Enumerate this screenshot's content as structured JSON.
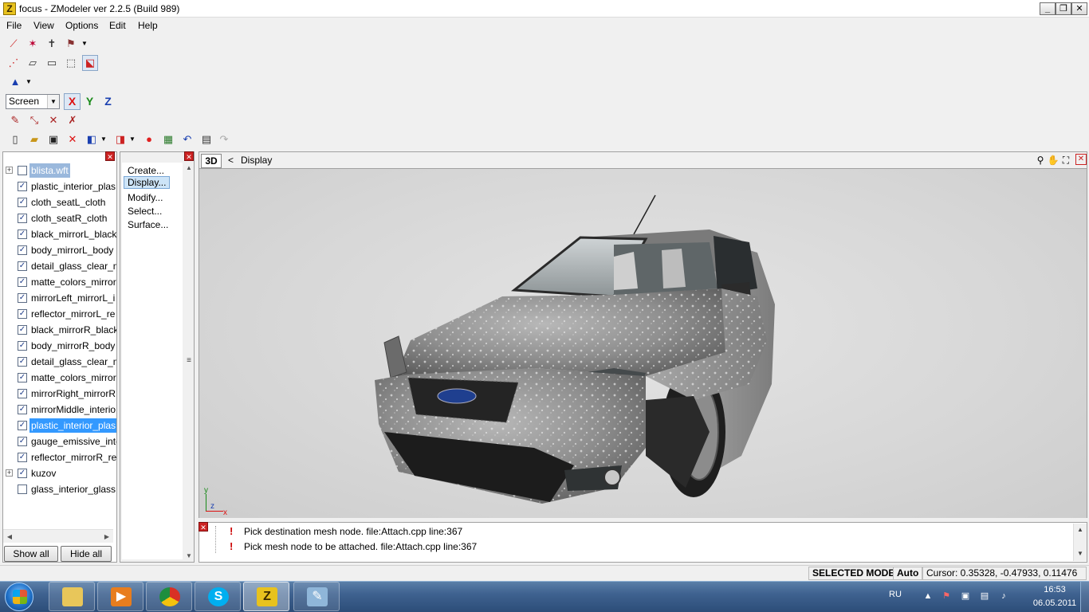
{
  "window": {
    "app_icon_letter": "Z",
    "title": "focus - ZModeler ver 2.2.5 (Build 989)",
    "minimize": "_",
    "maximize": "❐",
    "close": "✕"
  },
  "menu": {
    "items": [
      "File",
      "View",
      "Options",
      "Edit",
      "Help"
    ]
  },
  "toolbar": {
    "space_select": "Screen",
    "axis_x": "X",
    "axis_y": "Y",
    "axis_z": "Z"
  },
  "tree": {
    "close": "✕",
    "items": [
      {
        "label": "blista.wft",
        "checked": false,
        "expander": "+",
        "state": "root-selected"
      },
      {
        "label": "plastic_interior_plas",
        "checked": true
      },
      {
        "label": "cloth_seatL_cloth",
        "checked": true
      },
      {
        "label": "cloth_seatR_cloth",
        "checked": true
      },
      {
        "label": "black_mirrorL_black",
        "checked": true
      },
      {
        "label": "body_mirrorL_body",
        "checked": true
      },
      {
        "label": "detail_glass_clear_m",
        "checked": true
      },
      {
        "label": "matte_colors_mirror",
        "checked": true
      },
      {
        "label": "mirrorLeft_mirrorL_i",
        "checked": true
      },
      {
        "label": "reflector_mirrorL_re",
        "checked": true
      },
      {
        "label": "black_mirrorR_black",
        "checked": true
      },
      {
        "label": "body_mirrorR_body",
        "checked": true
      },
      {
        "label": "detail_glass_clear_m",
        "checked": true
      },
      {
        "label": "matte_colors_mirror",
        "checked": true
      },
      {
        "label": "mirrorRight_mirrorR",
        "checked": true
      },
      {
        "label": "mirrorMiddle_interio",
        "checked": true
      },
      {
        "label": "plastic_interior_plas",
        "checked": true,
        "state": "selected"
      },
      {
        "label": "gauge_emissive_inte",
        "checked": true
      },
      {
        "label": "reflector_mirrorR_re",
        "checked": true
      },
      {
        "label": "kuzov",
        "checked": true,
        "expander": "+"
      },
      {
        "label": "glass_interior_glass",
        "checked": false
      }
    ],
    "show_all": "Show all",
    "hide_all": "Hide all"
  },
  "commands": {
    "items": [
      "Create...",
      "Display...",
      "Modify...",
      "Select...",
      "Surface..."
    ],
    "selected_index": 1
  },
  "viewport": {
    "mode_button": "3D",
    "back": "<",
    "breadcrumb": "Display",
    "axis_y": "y",
    "axis_z": "z",
    "axis_x": "x"
  },
  "log": {
    "close": "✕",
    "icon": "!",
    "lines": [
      "Pick destination mesh node. file:Attach.cpp line:367",
      "Pick mesh node to be attached. file:Attach.cpp line:367"
    ]
  },
  "status": {
    "mode": "SELECTED MODE",
    "auto": "Auto",
    "cursor": "Cursor: 0.35328, -0.47933, 0.11476"
  },
  "taskbar": {
    "zmodeler_letter": "Z",
    "lang": "RU",
    "time": "16:53",
    "date": "06.05.2011"
  }
}
